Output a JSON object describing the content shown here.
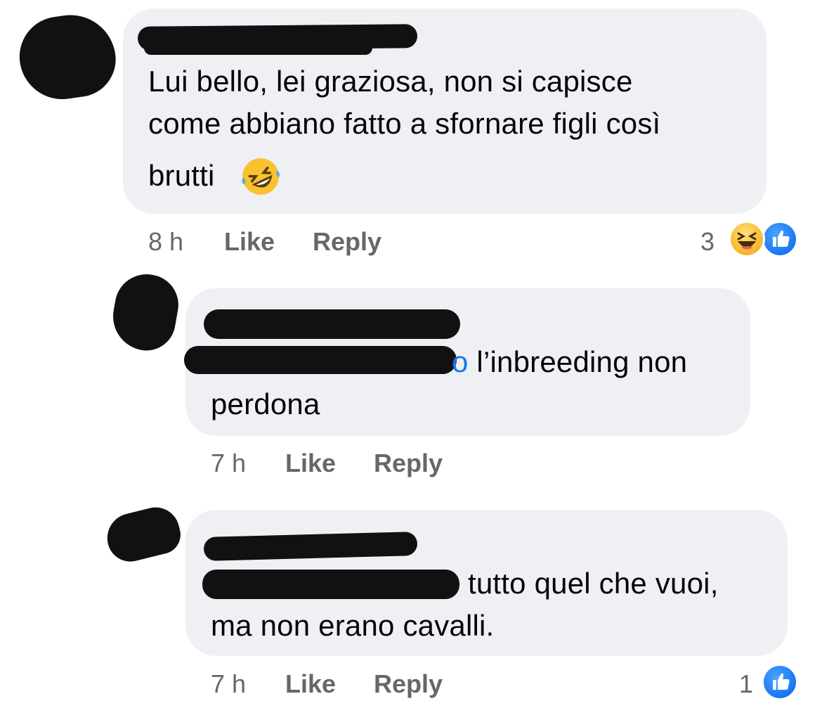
{
  "colors": {
    "bubble": "#eff0f4",
    "meta_text": "#65676b",
    "mention": "#1877f2",
    "like_blue": "#1877f2",
    "haha_yellow": "#f7b125",
    "redaction": "#111111"
  },
  "comments": [
    {
      "text_lines": [
        "Lui bello, lei graziosa, non si capisce",
        "come abbiano fatto a sfornare figli così",
        "brutti"
      ],
      "emoji": "rolling-on-floor-laughing",
      "time": "8 h",
      "like_label": "Like",
      "reply_label": "Reply",
      "reaction_count": "3",
      "reactions": [
        "haha",
        "like"
      ]
    },
    {
      "mention_tail": "o",
      "text_line1": " l’inbreeding non",
      "text_line2": "perdona",
      "time": "7 h",
      "like_label": "Like",
      "reply_label": "Reply"
    },
    {
      "text_line1": "tutto quel che vuoi,",
      "text_line2": "ma non erano cavalli.",
      "time": "7 h",
      "like_label": "Like",
      "reply_label": "Reply",
      "reaction_count": "1",
      "reactions": [
        "like"
      ]
    }
  ]
}
